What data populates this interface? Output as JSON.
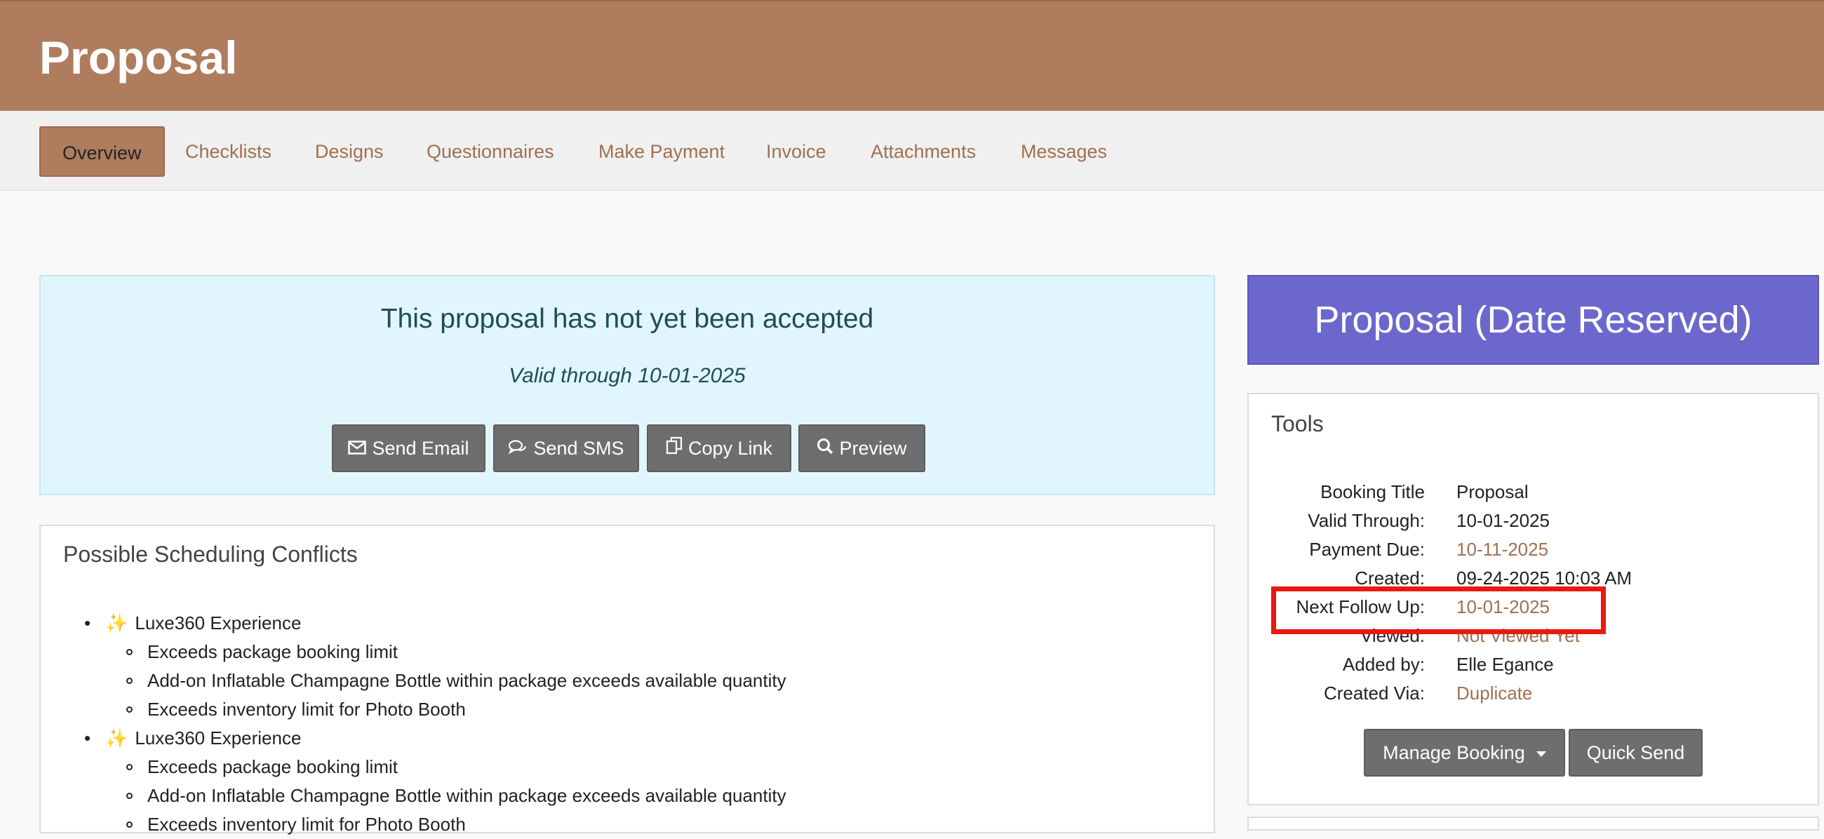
{
  "header": {
    "title": "Proposal"
  },
  "tabs": [
    {
      "label": "Overview",
      "active": true
    },
    {
      "label": "Checklists"
    },
    {
      "label": "Designs"
    },
    {
      "label": "Questionnaires"
    },
    {
      "label": "Make Payment"
    },
    {
      "label": "Invoice"
    },
    {
      "label": "Attachments"
    },
    {
      "label": "Messages"
    }
  ],
  "alert": {
    "title": "This proposal has not yet been accepted",
    "valid": "Valid through 10-01-2025",
    "buttons": [
      {
        "label": "Send Email",
        "icon": "envelope-icon"
      },
      {
        "label": "Send SMS",
        "icon": "chat-icon"
      },
      {
        "label": "Copy Link",
        "icon": "copy-icon"
      },
      {
        "label": "Preview",
        "icon": "search-icon"
      }
    ]
  },
  "conflicts": {
    "title": "Possible Scheduling Conflicts",
    "items": [
      {
        "label": "Luxe360 Experience",
        "icon": "sparkles-icon",
        "subs": [
          "Exceeds package booking limit",
          "Add-on Inflatable Champagne Bottle within package exceeds available quantity",
          "Exceeds inventory limit for Photo Booth"
        ]
      },
      {
        "label": "Luxe360 Experience",
        "icon": "sparkles-icon",
        "subs": [
          "Exceeds package booking limit",
          "Add-on Inflatable Champagne Bottle within package exceeds available quantity",
          "Exceeds inventory limit for Photo Booth"
        ]
      }
    ]
  },
  "status": {
    "label": "Proposal (Date Reserved)",
    "color": "#6c67cc"
  },
  "tools": {
    "title": "Tools",
    "rows": [
      {
        "label": "Booking Title",
        "value": "Proposal"
      },
      {
        "label": "Valid Through:",
        "value": "10-01-2025"
      },
      {
        "label": "Payment Due:",
        "value": "10-11-2025"
      },
      {
        "label": "Created:",
        "value": "09-24-2025 10:03 AM"
      },
      {
        "label": "Next Follow Up:",
        "value": "10-01-2025"
      },
      {
        "label": "Viewed:",
        "value": "Not Viewed Yet"
      },
      {
        "label": "Added by:",
        "value": "Elle Egance"
      },
      {
        "label": "Created Via:",
        "value": "Duplicate"
      }
    ],
    "manage_label": "Manage Booking",
    "quick_send_label": "Quick Send"
  },
  "colors": {
    "brand": "#af7c5e",
    "link": "#a0704f",
    "highlight": "#e8190e"
  }
}
